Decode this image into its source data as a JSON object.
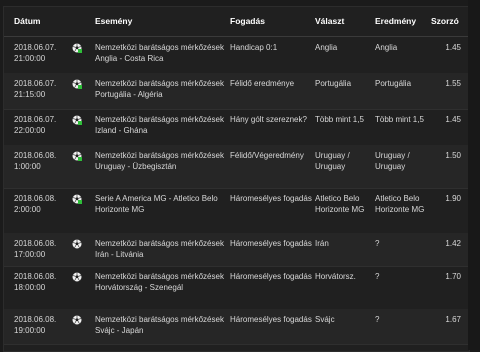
{
  "columns": {
    "date": "Dátum",
    "event": "Esemény",
    "bet": "Fogadás",
    "selection": "Választ",
    "result": "Eredmény",
    "odds": "Szorzó"
  },
  "colors": {
    "background": "#202020",
    "row_alt": "#262626",
    "text": "#d8d8d8",
    "header_text": "#ffffff",
    "live_badge": "#2fbf3a"
  },
  "rows": [
    {
      "date_day": "2018.06.07.",
      "date_time": "21:00:00",
      "icon": "soccer-ball-live-icon",
      "event": "Nemzetközi barátságos mérkőzések Anglia - Costa Rica",
      "bet": "Handicap 0:1",
      "selection": "Anglia",
      "result": "Anglia",
      "odds": "1.45"
    },
    {
      "date_day": "2018.06.07.",
      "date_time": "21:15:00",
      "icon": "soccer-ball-live-icon",
      "event": "Nemzetközi barátságos mérkőzések Portugália - Algéria",
      "bet": "Félidő eredménye",
      "selection": "Portugália",
      "result": "Portugália",
      "odds": "1.55"
    },
    {
      "date_day": "2018.06.07.",
      "date_time": "22:00:00",
      "icon": "soccer-ball-live-icon",
      "event": "Nemzetközi barátságos mérkőzések Izland - Ghána",
      "bet": "Hány gólt szereznek?",
      "selection": "Több mint 1,5",
      "result": "Több mint 1,5",
      "odds": "1.45"
    },
    {
      "date_day": "2018.06.08.",
      "date_time": "1:00:00",
      "icon": "soccer-ball-live-icon",
      "event": "Nemzetközi barátságos mérkőzések Uruguay - Üzbegisztán",
      "bet": "Félidő/Végeredmény",
      "selection": "Uruguay / Uruguay",
      "result": "Uruguay / Uruguay",
      "odds": "1.50"
    },
    {
      "date_day": "2018.06.08.",
      "date_time": "2:00:00",
      "icon": "soccer-ball-live-icon",
      "event": "Serie A America MG - Atletico Belo Horizonte MG",
      "bet": "Háromesélyes fogadás",
      "selection": "Atletico Belo Horizonte MG",
      "result": "Atletico Belo Horizonte MG",
      "odds": "1.90"
    },
    {
      "date_day": "2018.06.08.",
      "date_time": "17:00:00",
      "icon": "soccer-ball-icon",
      "event": "Nemzetközi barátságos mérkőzések Irán - Litvánia",
      "bet": "Háromesélyes fogadás",
      "selection": "Irán",
      "result": "?",
      "odds": "1.42"
    },
    {
      "date_day": "2018.06.08.",
      "date_time": "18:00:00",
      "icon": "soccer-ball-icon",
      "event": "Nemzetközi barátságos mérkőzések Horvátország - Szenegál",
      "bet": "Háromesélyes fogadás",
      "selection": "Horvátorsz.",
      "result": "?",
      "odds": "1.70"
    },
    {
      "date_day": "2018.06.08.",
      "date_time": "19:00:00",
      "icon": "soccer-ball-icon",
      "event": "Nemzetközi barátságos mérkőzések Svájc - Japán",
      "bet": "Háromesélyes fogadás",
      "selection": "Svájc",
      "result": "?",
      "odds": "1.67"
    }
  ]
}
